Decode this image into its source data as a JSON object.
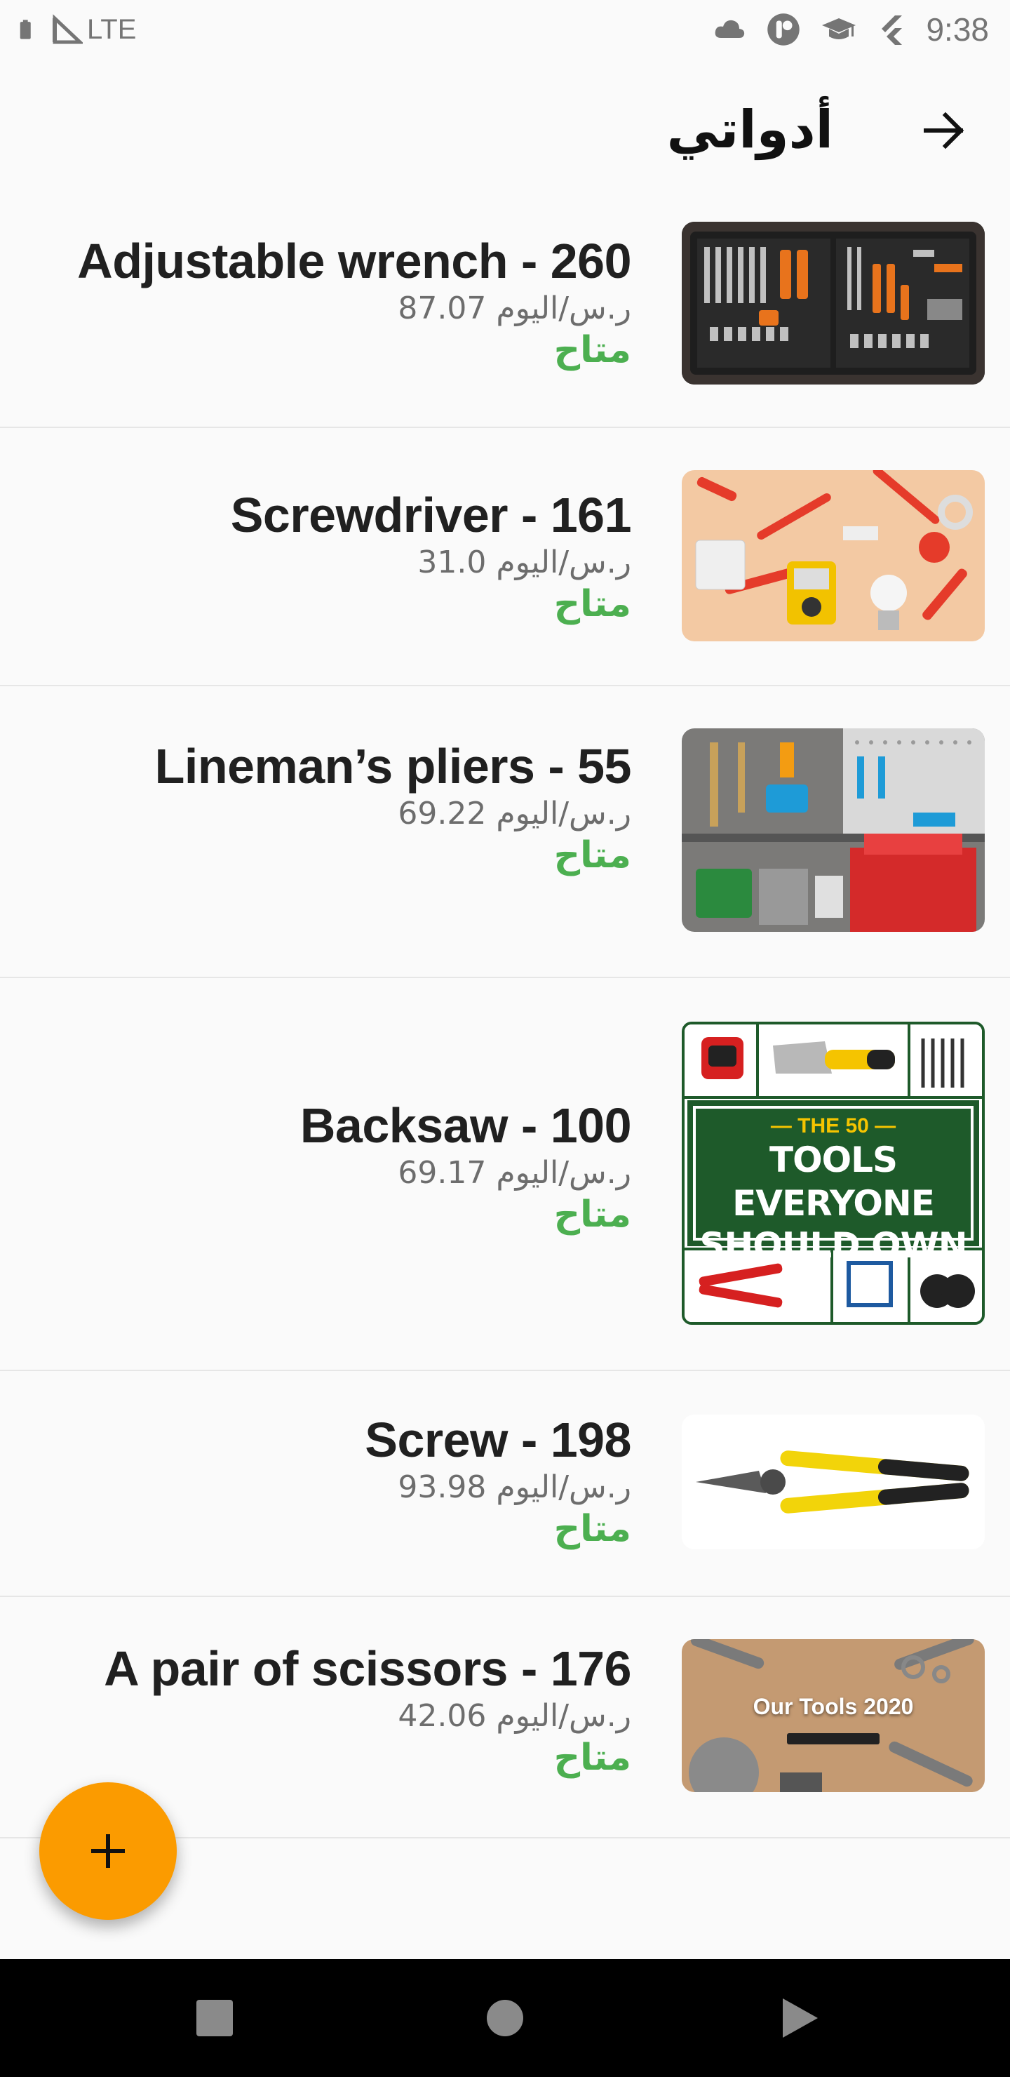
{
  "status_bar": {
    "network": "LTE",
    "time": "9:38",
    "icons": [
      "battery-icon",
      "signal-icon",
      "cloud-icon",
      "app-notification-icon",
      "graduation-cap-icon",
      "flutter-icon"
    ]
  },
  "app_bar": {
    "title": "أدواتي",
    "back_icon": "arrow-right-icon"
  },
  "tools": [
    {
      "title": "Adjustable wrench - 260",
      "price": "87.07 ر.س/اليوم",
      "status": "متاح",
      "image": "toolbox-set-image"
    },
    {
      "title": "Screwdriver - 161",
      "price": "31.0 ر.س/اليوم",
      "status": "متاح",
      "image": "electrical-tools-image"
    },
    {
      "title": "Lineman’s pliers - 55",
      "price": "69.22 ر.س/اليوم",
      "status": "متاح",
      "image": "workshop-wall-image"
    },
    {
      "title": "Backsaw - 100",
      "price": "69.17 ر.س/اليوم",
      "status": "متاح",
      "image": "tools-poster-image",
      "poster_text": {
        "line1": "— THE 50 —",
        "line2": "TOOLS EVERYONE",
        "line3": "SHOULD OWN"
      }
    },
    {
      "title": "Screw - 198",
      "price": "93.98 ر.س/اليوم",
      "status": "متاح",
      "image": "pliers-image"
    },
    {
      "title": "A pair of scissors - 176",
      "price": "42.06 ر.س/اليوم",
      "status": "متاح",
      "image": "our-tools-image",
      "banner_text": "Our Tools 2020"
    }
  ],
  "fab": {
    "icon": "plus-icon"
  },
  "nav_bar": {
    "icons": [
      "recent-apps-icon",
      "home-icon",
      "back-icon"
    ]
  },
  "colors": {
    "available": "#4caf50",
    "fab": "#fb9b00",
    "nav_background": "#000000"
  }
}
